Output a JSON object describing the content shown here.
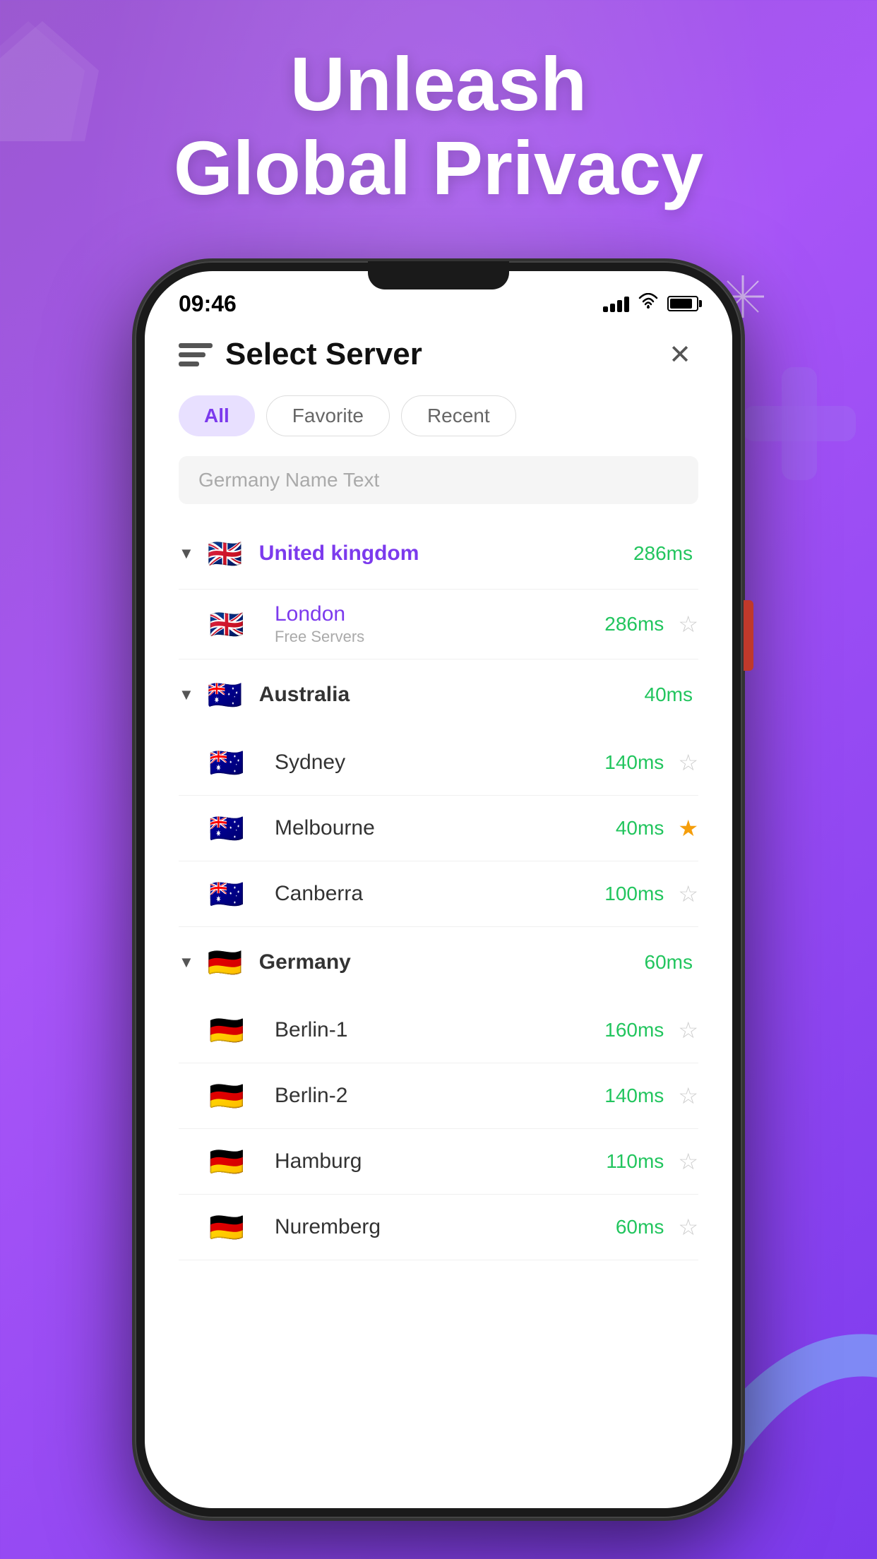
{
  "background": {
    "gradient_start": "#a855f7",
    "gradient_end": "#7c3aed"
  },
  "hero": {
    "line1": "Unleash",
    "line2": "Global Privacy"
  },
  "status_bar": {
    "time": "09:46",
    "signal_bars": 4,
    "wifi": true,
    "battery": 85
  },
  "app": {
    "title": "Select Server",
    "tabs": [
      {
        "label": "All",
        "active": true
      },
      {
        "label": "Favorite",
        "active": false
      },
      {
        "label": "Recent",
        "active": false
      }
    ],
    "search_placeholder": "Germany Name Text",
    "countries": [
      {
        "name": "United kingdom",
        "flag": "🇬🇧",
        "ping": "286ms",
        "active": true,
        "expanded": true,
        "cities": [
          {
            "name": "London",
            "subtitle": "Free Servers",
            "ping": "286ms",
            "starred": false,
            "active": true
          }
        ]
      },
      {
        "name": "Australia",
        "flag": "🇦🇺",
        "ping": "40ms",
        "active": false,
        "expanded": true,
        "cities": [
          {
            "name": "Sydney",
            "subtitle": "",
            "ping": "140ms",
            "starred": false,
            "active": false
          },
          {
            "name": "Melbourne",
            "subtitle": "",
            "ping": "40ms",
            "starred": true,
            "active": false
          },
          {
            "name": "Canberra",
            "subtitle": "",
            "ping": "100ms",
            "starred": false,
            "active": false
          }
        ]
      },
      {
        "name": "Germany",
        "flag": "🇩🇪",
        "ping": "60ms",
        "active": false,
        "expanded": true,
        "cities": [
          {
            "name": "Berlin-1",
            "subtitle": "",
            "ping": "160ms",
            "starred": false,
            "active": false
          },
          {
            "name": "Berlin-2",
            "subtitle": "",
            "ping": "140ms",
            "starred": false,
            "active": false
          },
          {
            "name": "Hamburg",
            "subtitle": "",
            "ping": "110ms",
            "starred": false,
            "active": false
          },
          {
            "name": "Nuremberg",
            "subtitle": "",
            "ping": "60ms",
            "starred": false,
            "active": false
          }
        ]
      }
    ]
  }
}
